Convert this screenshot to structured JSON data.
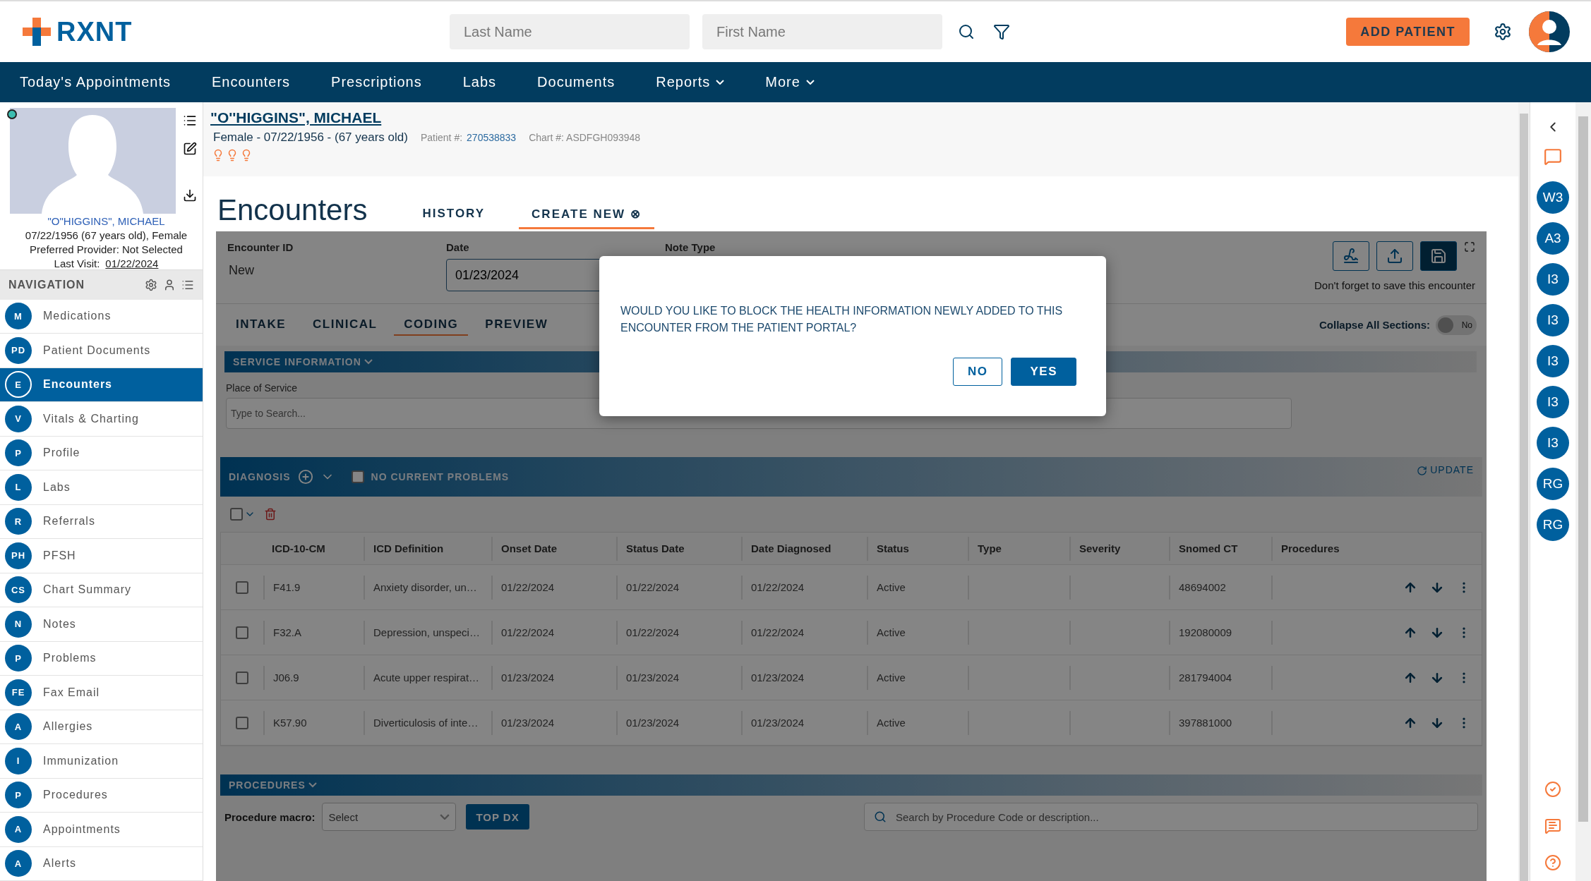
{
  "header": {
    "logo": "RXNT",
    "last_name_placeholder": "Last Name",
    "first_name_placeholder": "First Name",
    "add_patient": "ADD PATIENT"
  },
  "nav": [
    {
      "label": "Today's Appointments",
      "dropdown": false
    },
    {
      "label": "Encounters",
      "dropdown": false
    },
    {
      "label": "Prescriptions",
      "dropdown": false
    },
    {
      "label": "Labs",
      "dropdown": false
    },
    {
      "label": "Documents",
      "dropdown": false
    },
    {
      "label": "Reports",
      "dropdown": true
    },
    {
      "label": "More",
      "dropdown": true
    }
  ],
  "patient_card": {
    "online": true,
    "name": "\"O\"HIGGINS\", MICHAEL",
    "dob_line": "07/22/1956 (67 years old), Female",
    "provider": "Preferred Provider: Not Selected",
    "last_visit_label": "Last Visit:",
    "last_visit": "01/22/2024"
  },
  "sidebar": {
    "title": "NAVIGATION",
    "items": [
      {
        "abbr": "M",
        "label": "Medications",
        "selected": false
      },
      {
        "abbr": "PD",
        "label": "Patient Documents",
        "selected": false
      },
      {
        "abbr": "E",
        "label": "Encounters",
        "selected": true
      },
      {
        "abbr": "V",
        "label": "Vitals & Charting",
        "selected": false
      },
      {
        "abbr": "P",
        "label": "Profile",
        "selected": false
      },
      {
        "abbr": "L",
        "label": "Labs",
        "selected": false
      },
      {
        "abbr": "R",
        "label": "Referrals",
        "selected": false
      },
      {
        "abbr": "PH",
        "label": "PFSH",
        "selected": false
      },
      {
        "abbr": "CS",
        "label": "Chart Summary",
        "selected": false
      },
      {
        "abbr": "N",
        "label": "Notes",
        "selected": false
      },
      {
        "abbr": "P",
        "label": "Problems",
        "selected": false
      },
      {
        "abbr": "FE",
        "label": "Fax Email",
        "selected": false
      },
      {
        "abbr": "A",
        "label": "Allergies",
        "selected": false
      },
      {
        "abbr": "I",
        "label": "Immunization",
        "selected": false
      },
      {
        "abbr": "P",
        "label": "Procedures",
        "selected": false
      },
      {
        "abbr": "A",
        "label": "Appointments",
        "selected": false
      },
      {
        "abbr": "A",
        "label": "Alerts",
        "selected": false
      }
    ]
  },
  "patient_header": {
    "name": "\"O''HIGGINS\", MICHAEL",
    "summary": "Female - 07/22/1956 - (67 years old)",
    "patient_no_label": "Patient #:",
    "patient_no": "270538833",
    "chart_no": "Chart #: ASDFGH093948"
  },
  "page": {
    "title": "Encounters",
    "tabs": [
      {
        "label": "HISTORY",
        "selected": false
      },
      {
        "label": "CREATE NEW ⊗",
        "selected": true
      }
    ]
  },
  "encounter": {
    "id_label": "Encounter ID",
    "id_value": "New",
    "date_label": "Date",
    "date_value": "01/23/2024",
    "note_type_label": "Note Type",
    "save_hint": "Don't forget to save this encounter",
    "section_tabs": [
      {
        "label": "INTAKE",
        "selected": false
      },
      {
        "label": "CLINICAL",
        "selected": false
      },
      {
        "label": "CODING",
        "selected": true
      },
      {
        "label": "PREVIEW",
        "selected": false
      }
    ],
    "collapse": {
      "label": "Collapse All Sections:",
      "on": false,
      "state_text": "No"
    },
    "service": {
      "title": "SERVICE INFORMATION",
      "place_label": "Place of Service",
      "placeholder": "Type to Search..."
    },
    "diagnosis": {
      "title": "DIAGNOSIS",
      "select_all": {
        "checked": false
      },
      "no_problems": {
        "label": "NO CURRENT PROBLEMS",
        "checked": false
      },
      "update": "UPDATE",
      "columns": [
        "ICD-10-CM",
        "ICD Definition",
        "Onset Date",
        "Status Date",
        "Date Diagnosed",
        "Status",
        "Type",
        "Severity",
        "Snomed CT",
        "Procedures"
      ],
      "rows": [
        {
          "checked": false,
          "cells": [
            "F41.9",
            "Anxiety disorder, un…",
            "01/22/2024",
            "01/22/2024",
            "01/22/2024",
            "Active",
            "",
            "",
            "48694002",
            ""
          ]
        },
        {
          "checked": false,
          "cells": [
            "F32.A",
            "Depression, unspeci…",
            "01/22/2024",
            "01/22/2024",
            "01/22/2024",
            "Active",
            "",
            "",
            "192080009",
            ""
          ]
        },
        {
          "checked": false,
          "cells": [
            "J06.9",
            "Acute upper respirat…",
            "01/23/2024",
            "01/23/2024",
            "01/23/2024",
            "Active",
            "",
            "",
            "281794004",
            ""
          ]
        },
        {
          "checked": false,
          "cells": [
            "K57.90",
            "Diverticulosis of inte…",
            "01/23/2024",
            "01/23/2024",
            "01/23/2024",
            "Active",
            "",
            "",
            "397881000",
            ""
          ]
        }
      ]
    },
    "procedures": {
      "title": "PROCEDURES",
      "macro_label": "Procedure macro:",
      "macro_placeholder": "Select",
      "top_dx": "TOP DX",
      "search_placeholder": "Search by Procedure Code or description..."
    }
  },
  "dialog": {
    "message": "WOULD YOU LIKE TO BLOCK THE HEALTH INFORMATION NEWLY ADDED TO THIS ENCOUNTER FROM THE PATIENT PORTAL?",
    "buttons": [
      {
        "label": "NO",
        "kind": "secondary"
      },
      {
        "label": "YES",
        "kind": "primary"
      }
    ]
  },
  "right_rail": {
    "badges": [
      "W3",
      "A3",
      "I3",
      "I3",
      "I3",
      "I3",
      "I3",
      "RG",
      "RG"
    ]
  }
}
